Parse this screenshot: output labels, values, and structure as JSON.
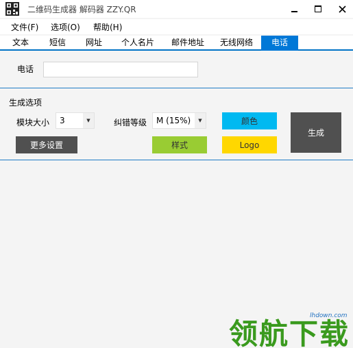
{
  "window": {
    "title": "二维码生成器 解码器 ZZY.QR",
    "icon": "qr-code-icon",
    "controls": {
      "minimize": "minimize-icon",
      "maximize": "maximize-icon",
      "close": "close-icon"
    }
  },
  "menu": {
    "items": [
      {
        "label": "文件(F)"
      },
      {
        "label": "选项(O)"
      },
      {
        "label": "帮助(H)"
      }
    ]
  },
  "tabs": {
    "active": "电话",
    "items": [
      {
        "label": "文本"
      },
      {
        "label": "短信"
      },
      {
        "label": "网址"
      },
      {
        "label": "个人名片"
      },
      {
        "label": "邮件地址"
      },
      {
        "label": "无线网络"
      },
      {
        "label": "电话"
      }
    ]
  },
  "phone": {
    "label": "电话",
    "value": ""
  },
  "options": {
    "title": "生成选项",
    "module_size": {
      "label": "模块大小",
      "value": "3"
    },
    "error_correction": {
      "label": "纠错等级",
      "value": "M (15%)"
    },
    "color_button": "颜色",
    "generate_button": "生成",
    "more_settings_button": "更多设置",
    "style_button": "样式",
    "logo_button": "Logo"
  },
  "colors": {
    "accent": "#0078d7",
    "color_button": "#00b9f1",
    "style_button": "#99cc33",
    "logo_button": "#ffd700",
    "generate_button": "#505050",
    "more_settings_button": "#505050"
  },
  "watermark": {
    "url": "lhdown.com",
    "text": "领航下载"
  }
}
